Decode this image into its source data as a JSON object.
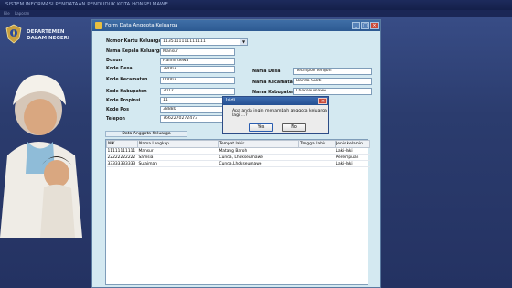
{
  "app": {
    "title": "SISTEM INFORMASI PENDATAAN PENDUDUK KOTA HONSELMAWE",
    "menu": [
      "File",
      "Laporan"
    ]
  },
  "logo": {
    "line1": "DEPARTEMEN",
    "line2": "DALAM NEGERI"
  },
  "form": {
    "title": "Form Data Anggota Keluarga",
    "fields": {
      "no_kk": {
        "label": "Nomor Kartu Keluarga",
        "value": "1135111111111111"
      },
      "kepala": {
        "label": "Nama Kepala Keluarga",
        "value": "Mansur"
      },
      "dusun": {
        "label": "Dusun",
        "value": "Halimi dewa"
      },
      "kode_desa": {
        "label": "Kode Desa",
        "value": "38003"
      },
      "kode_kec": {
        "label": "Kode Kecamatan",
        "value": "00002"
      },
      "kode_kab": {
        "label": "Kode Kabupaten",
        "value": "3012"
      },
      "kode_prop": {
        "label": "Kode Propinsi",
        "value": "11"
      },
      "kode_pos": {
        "label": "Kode Pos",
        "value": "38880"
      },
      "telepon": {
        "label": "Telepon",
        "value": "7662270272473"
      },
      "nama_desa": {
        "label": "Nama Desa",
        "value": "Teumpok Tengoh"
      },
      "nama_kec": {
        "label": "Nama Kecamatan",
        "value": "Banda Sakti"
      },
      "nama_kab": {
        "label": "Nama Kabupaten",
        "value": "Lhokseumawe"
      }
    },
    "table_title": "Data Anggota Keluarga",
    "table": {
      "headers": [
        "NIK",
        "Nama Lengkap",
        "Tempat lahir",
        "Tanggal lahir",
        "Jenis kelamin"
      ],
      "rows": [
        [
          "11111111111",
          "Mansur",
          "Matang Baroh",
          "",
          "Laki-laki"
        ],
        [
          "22222222222",
          "Samsia",
          "Cunda, Lhokseumawe",
          "",
          "Perempuan"
        ],
        [
          "33333333333",
          "Sulaiman",
          "Cunda,Lhokseumawe",
          "",
          "Laki-laki"
        ]
      ]
    }
  },
  "dialog": {
    "title": "Isidi",
    "message": "Apa anda ingin menambah anggota keluarga lagi ...?",
    "yes": "Yes",
    "no": "No"
  }
}
